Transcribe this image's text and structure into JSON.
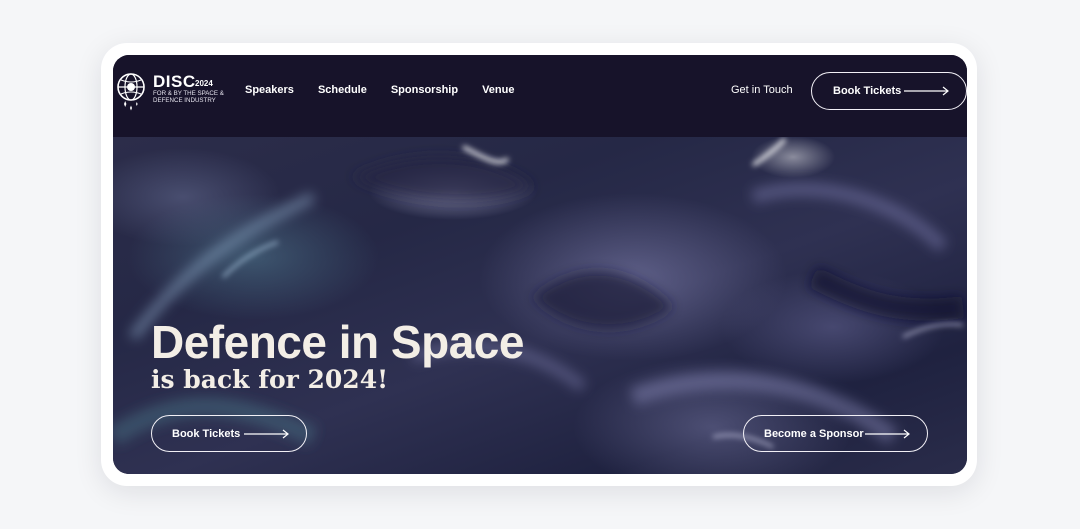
{
  "brand": {
    "title": "DISC",
    "year": "2024",
    "tagline": "FOR & BY THE SPACE & DEFENCE INDUSTRY",
    "logo_icon": "globe-satellite-icon"
  },
  "nav": {
    "links": [
      "Speakers",
      "Schedule",
      "Sponsorship",
      "Venue"
    ],
    "contact_label": "Get in Touch",
    "cta_label": "Book Tickets"
  },
  "hero": {
    "headline": "Defence in Space",
    "subheadline": "is back for 2024!",
    "primary_cta": "Book Tickets",
    "secondary_cta": "Become a Sponsor"
  },
  "colors": {
    "nav_bg": "#17132a",
    "hero_text": "#f3eee6",
    "frame_bg": "#ffffff",
    "page_bg": "#f5f6f8"
  }
}
